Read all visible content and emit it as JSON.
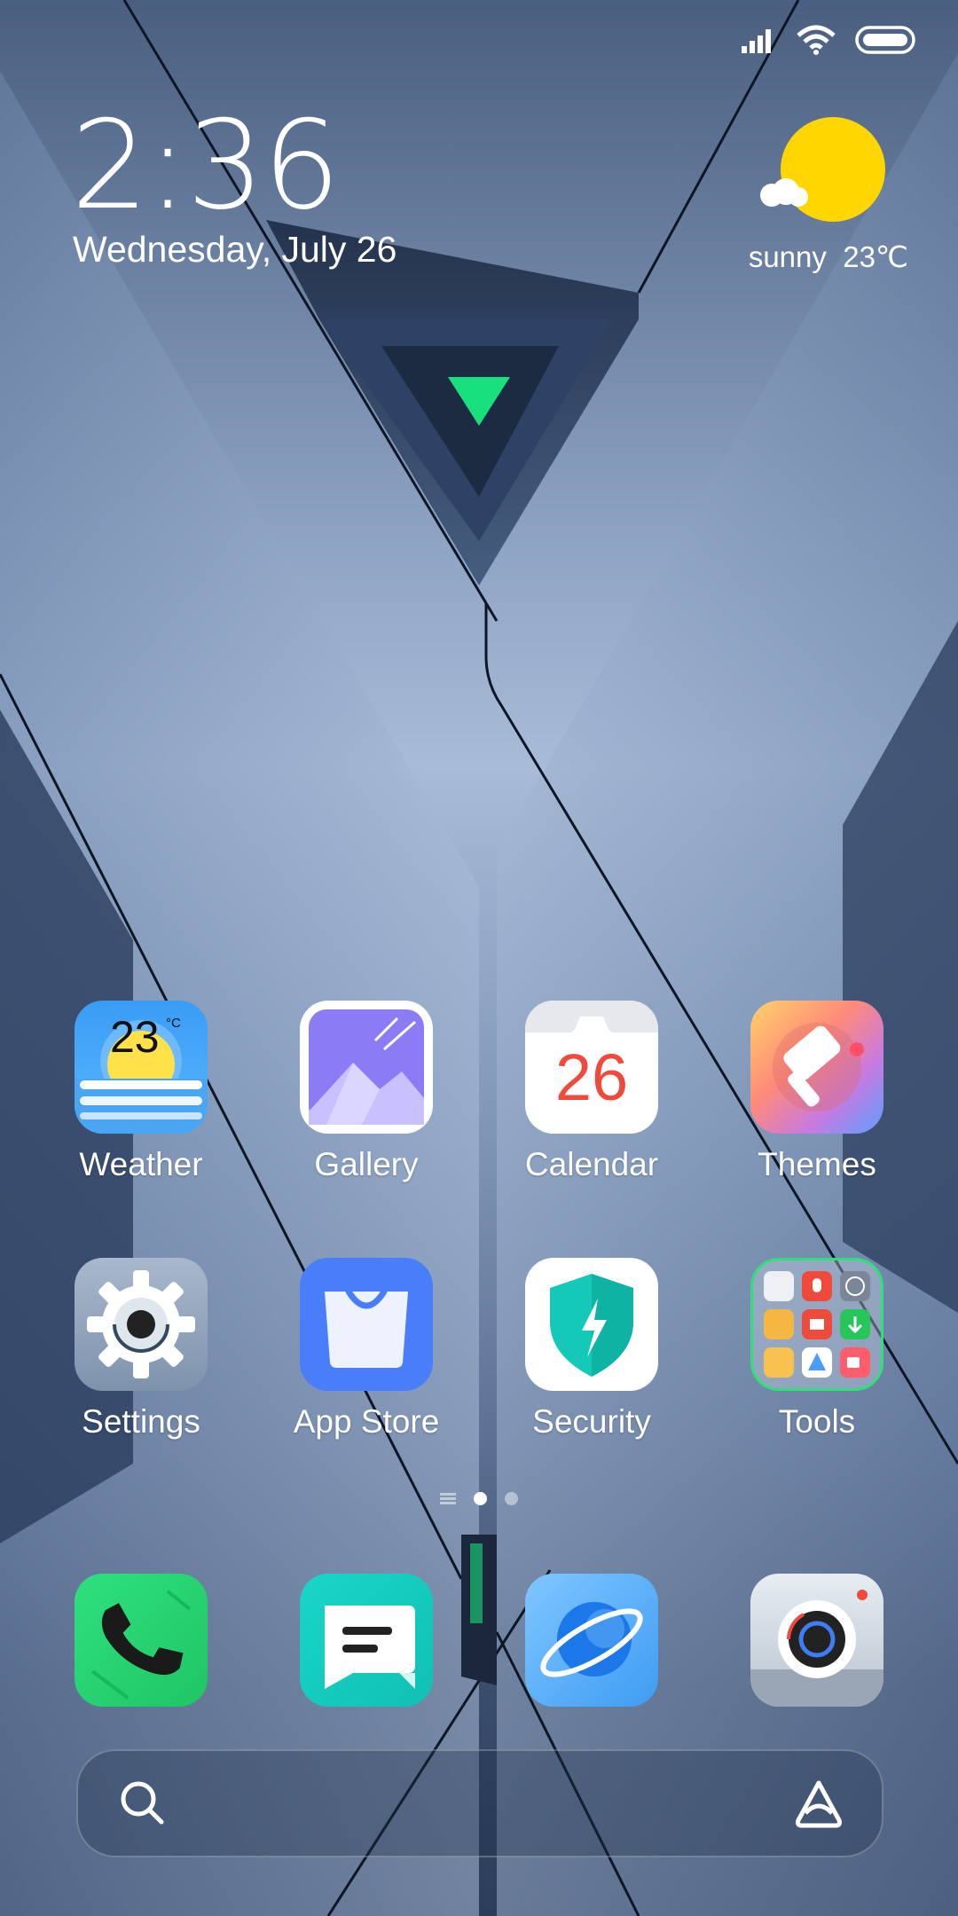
{
  "status_bar": {
    "icons": [
      "signal-icon",
      "wifi-icon",
      "battery-icon"
    ]
  },
  "lockscreen_widget": {
    "time": "2:36",
    "date": "Wednesday, July 26"
  },
  "weather_widget": {
    "icon": "sun-cloud-icon",
    "condition": "sunny",
    "temperature": "23℃"
  },
  "home_apps": [
    {
      "label": "Weather",
      "icon": "weather-app-icon",
      "badge_text": "23",
      "badge_unit": "°C"
    },
    {
      "label": "Gallery",
      "icon": "gallery-app-icon"
    },
    {
      "label": "Calendar",
      "icon": "calendar-app-icon",
      "day": "26"
    },
    {
      "label": "Themes",
      "icon": "themes-app-icon"
    },
    {
      "label": "Settings",
      "icon": "settings-app-icon"
    },
    {
      "label": "App Store",
      "icon": "app-store-icon"
    },
    {
      "label": "Security",
      "icon": "security-app-icon"
    },
    {
      "label": "Tools",
      "icon": "tools-folder-icon"
    }
  ],
  "page_indicator": {
    "pages": 2,
    "current": 1
  },
  "dock": [
    {
      "name": "phone",
      "icon": "phone-app-icon"
    },
    {
      "name": "messages",
      "icon": "messages-app-icon"
    },
    {
      "name": "browser",
      "icon": "browser-app-icon"
    },
    {
      "name": "camera",
      "icon": "camera-app-icon"
    }
  ],
  "search_bar": {
    "left_icon": "search-icon",
    "right_icon": "assistant-icon"
  },
  "colors": {
    "accent_green": "#19e07f",
    "sun_yellow": "#ffd600",
    "calendar_red": "#f04a3c"
  }
}
